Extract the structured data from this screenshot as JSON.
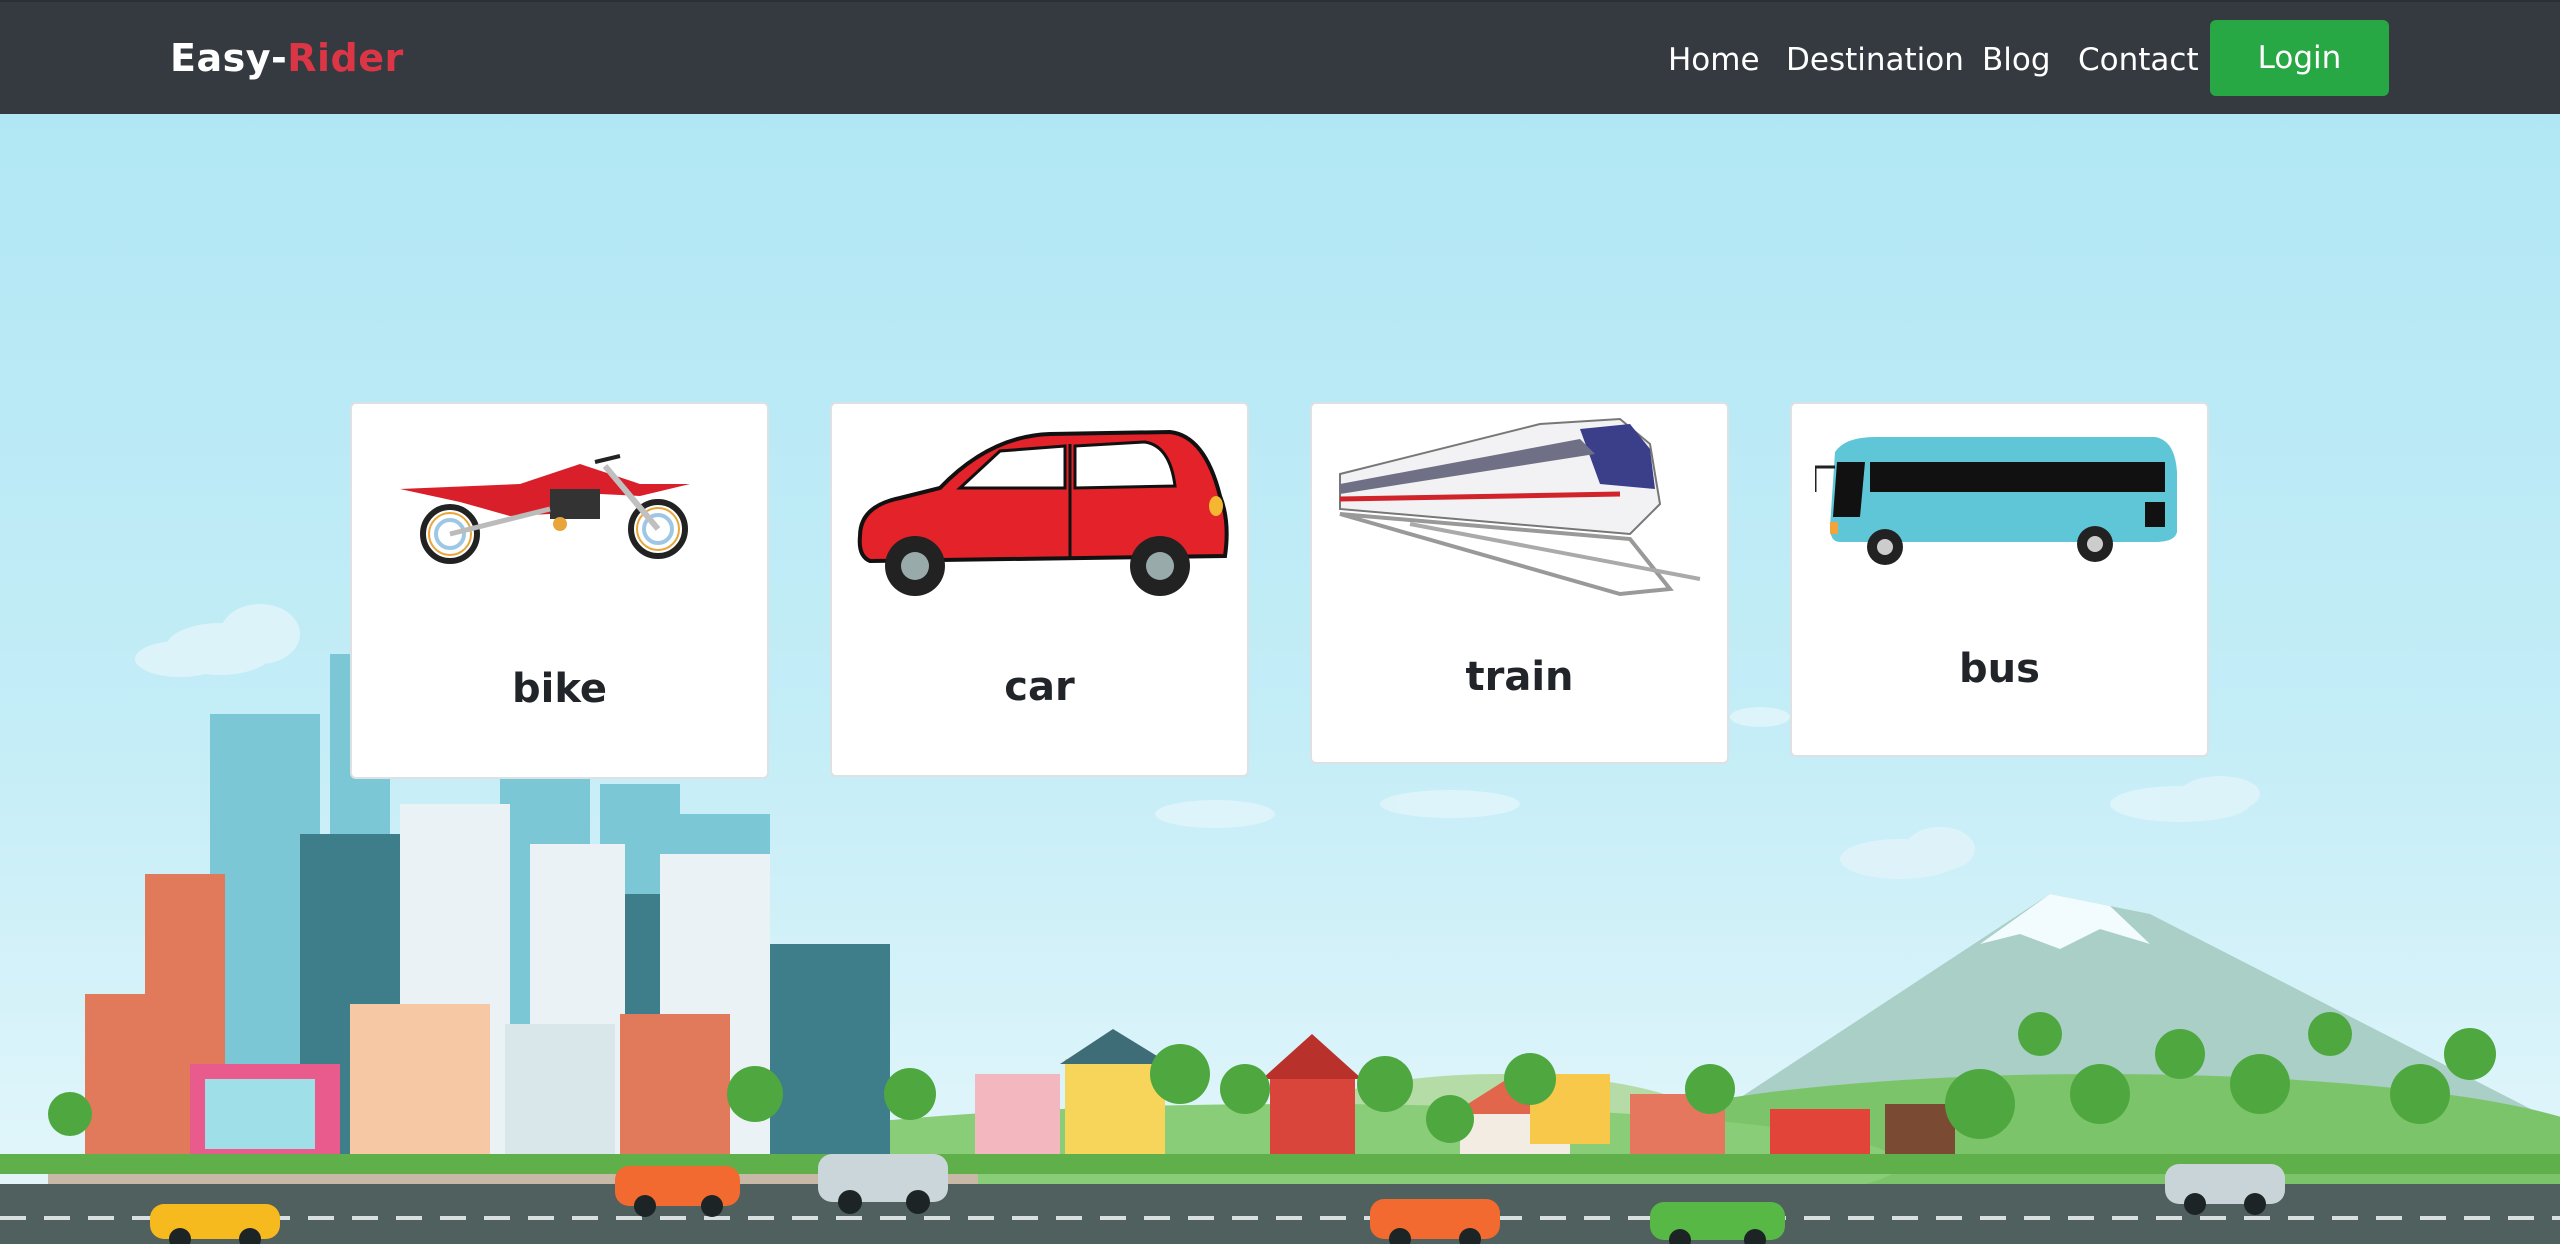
{
  "brand": {
    "part1": "Easy-",
    "part2": "Rider"
  },
  "nav": {
    "items": [
      "Home",
      "Destination",
      "Blog",
      "Contact"
    ],
    "login_label": "Login"
  },
  "vehicles": [
    {
      "name": "bike",
      "icon": "motorbike-icon"
    },
    {
      "name": "car",
      "icon": "car-icon"
    },
    {
      "name": "train",
      "icon": "train-icon"
    },
    {
      "name": "bus",
      "icon": "bus-icon"
    }
  ],
  "colors": {
    "navbar": "#343a40",
    "brand_accent": "#dc3545",
    "login_button": "#28a745",
    "sky": "#b3e6f3"
  }
}
